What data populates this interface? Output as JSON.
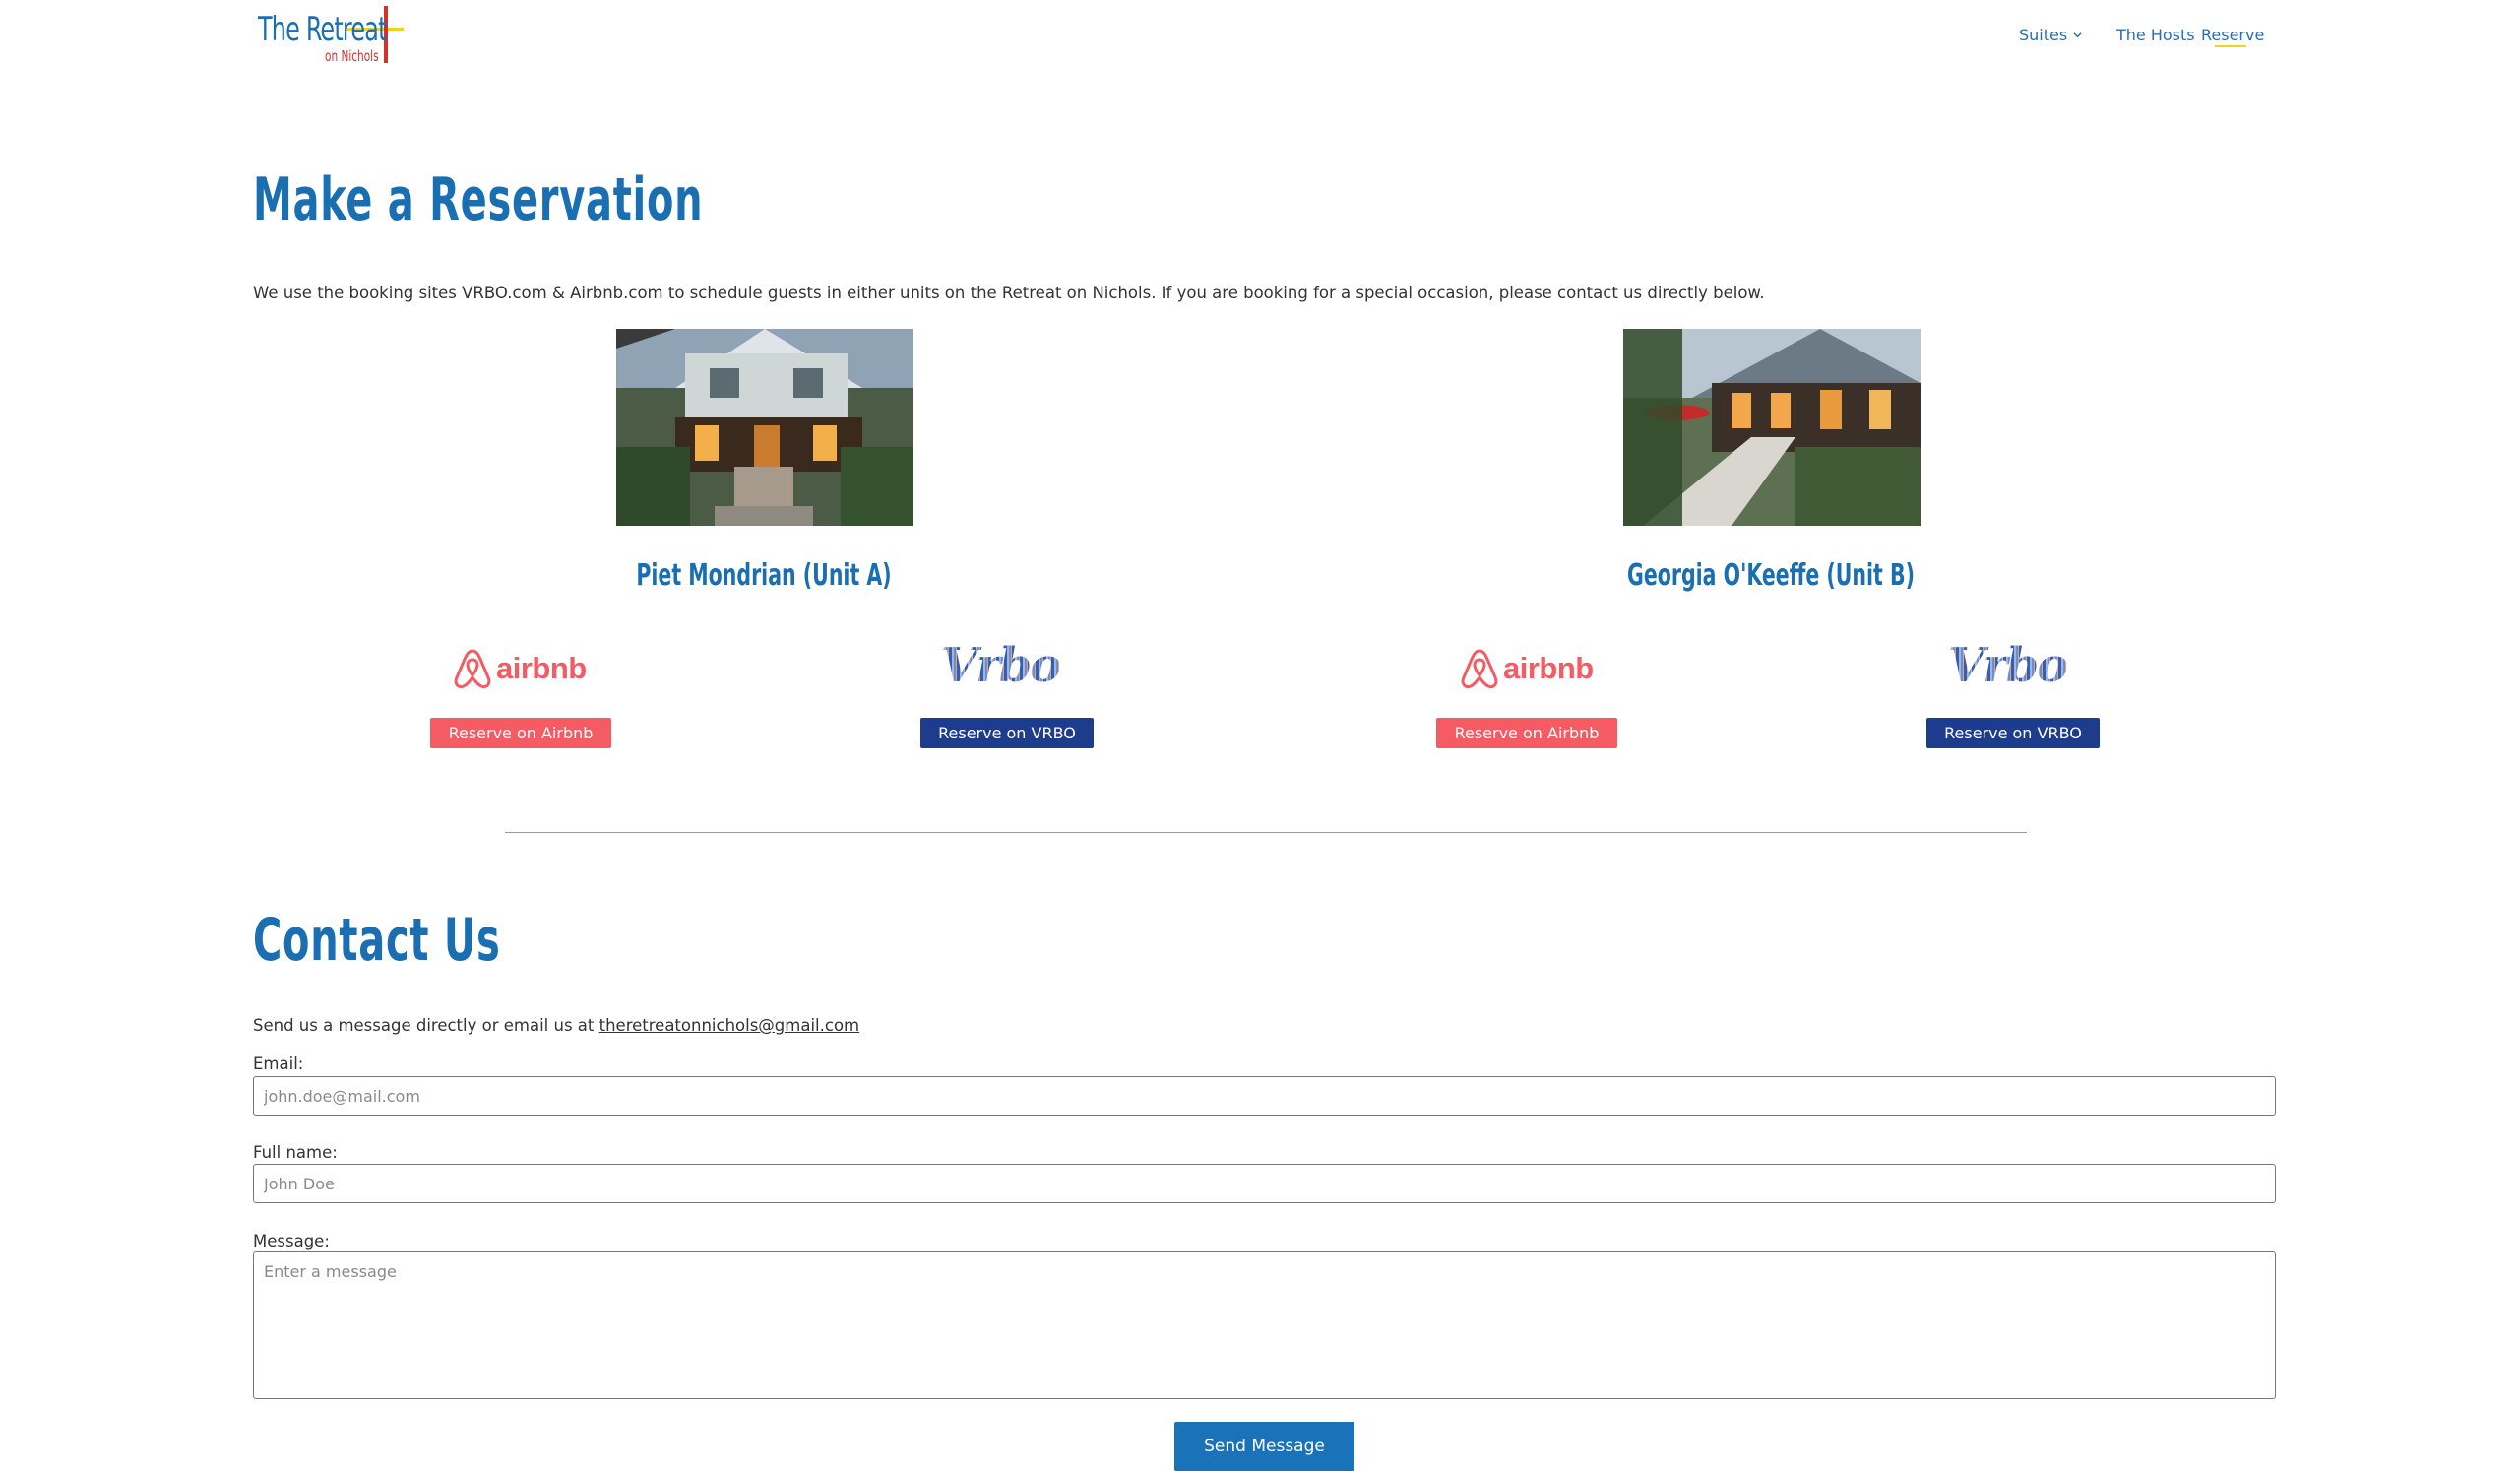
{
  "header": {
    "logo": {
      "line1": "The Retreat",
      "line2": "on Nichols"
    },
    "nav": {
      "suites": "Suites",
      "hosts": "The Hosts",
      "reserve": "Reserve"
    }
  },
  "reservation": {
    "title": "Make a Reservation",
    "intro": "We use the booking sites VRBO.com & Airbnb.com to schedule guests in either units on the Retreat on Nichols. If you are booking for a special occasion, please contact us directly below.",
    "suites": [
      {
        "name": "Piet Mondrian (Unit A)",
        "airbnb_logo": "airbnb",
        "vrbo_logo": "Vrbo",
        "airbnb_button": "Reserve on Airbnb",
        "vrbo_button": "Reserve on VRBO"
      },
      {
        "name": "Georgia O'Keeffe (Unit B)",
        "airbnb_logo": "airbnb",
        "vrbo_logo": "Vrbo",
        "airbnb_button": "Reserve on Airbnb",
        "vrbo_button": "Reserve on VRBO"
      }
    ]
  },
  "contact": {
    "title": "Contact Us",
    "intro_prefix": "Send us a message directly or email us at ",
    "email_link": "theretreatonnichols@gmail.com",
    "email_label": "Email:",
    "email_placeholder": "john.doe@mail.com",
    "name_label": "Full name:",
    "name_placeholder": "John Doe",
    "message_label": "Message:",
    "message_placeholder": "Enter a message",
    "send_button": "Send Message"
  },
  "colors": {
    "brand_blue": "#1a6fb3",
    "airbnb": "#f45b63",
    "vrbo": "#1d3c8c",
    "accent_yellow": "#f2d21b"
  }
}
